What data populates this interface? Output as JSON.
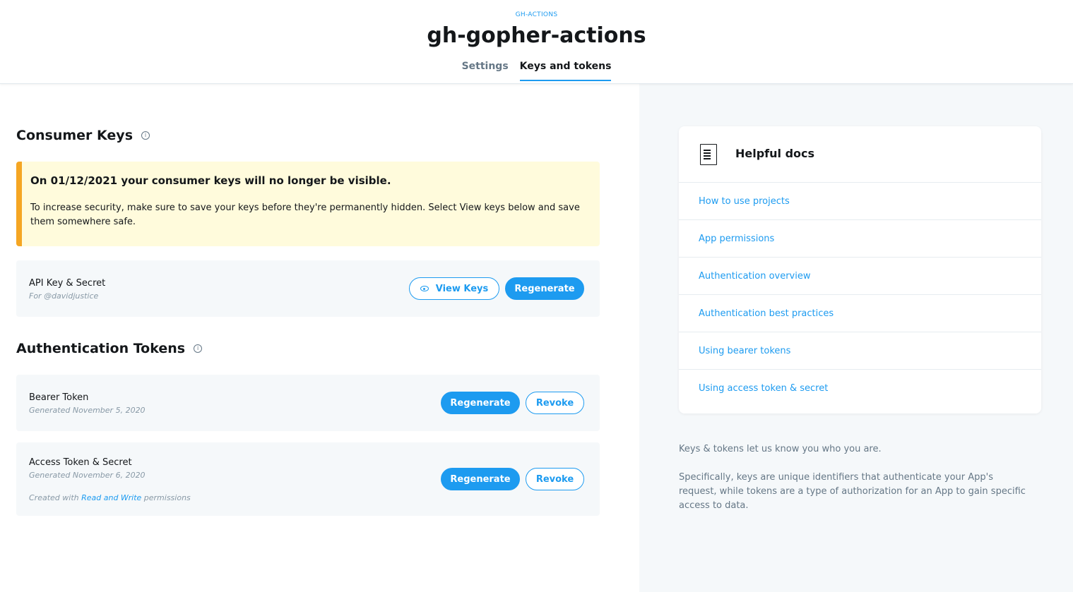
{
  "header": {
    "eyebrow": "GH-ACTIONS",
    "title": "gh-gopher-actions",
    "tabs": [
      {
        "label": "Settings",
        "active": false
      },
      {
        "label": "Keys and tokens",
        "active": true
      }
    ]
  },
  "consumer_keys": {
    "title": "Consumer Keys",
    "warning": {
      "title": "On 01/12/2021 your consumer keys will no longer be visible.",
      "body": "To increase security, make sure to save your keys before they're permanently hidden. Select View keys below and save them somewhere safe."
    },
    "api_key": {
      "title": "API Key & Secret",
      "subtitle": "For @davidjustice",
      "view_label": "View Keys",
      "regenerate_label": "Regenerate"
    }
  },
  "auth_tokens": {
    "title": "Authentication Tokens",
    "bearer": {
      "title": "Bearer Token",
      "subtitle": "Generated November 5, 2020",
      "regenerate_label": "Regenerate",
      "revoke_label": "Revoke"
    },
    "access": {
      "title": "Access Token & Secret",
      "subtitle": "Generated November 6, 2020",
      "perm_prefix": "Created with",
      "perm_link": "Read and Write",
      "perm_suffix": "permissions",
      "regenerate_label": "Regenerate",
      "revoke_label": "Revoke"
    }
  },
  "docs": {
    "title": "Helpful docs",
    "links": [
      "How to use projects",
      "App permissions",
      "Authentication overview",
      "Authentication best practices",
      "Using bearer tokens",
      "Using access token & secret"
    ]
  },
  "side_text": {
    "p1": "Keys & tokens let us know you who you are.",
    "p2": "Specifically, keys are unique identifiers that authenticate your App's request, while tokens are a type of authorization for an App to gain specific access to data."
  },
  "colors": {
    "accent": "#1d9bf0",
    "warning_bg": "#fffbdc",
    "warning_border": "#f5a623"
  }
}
